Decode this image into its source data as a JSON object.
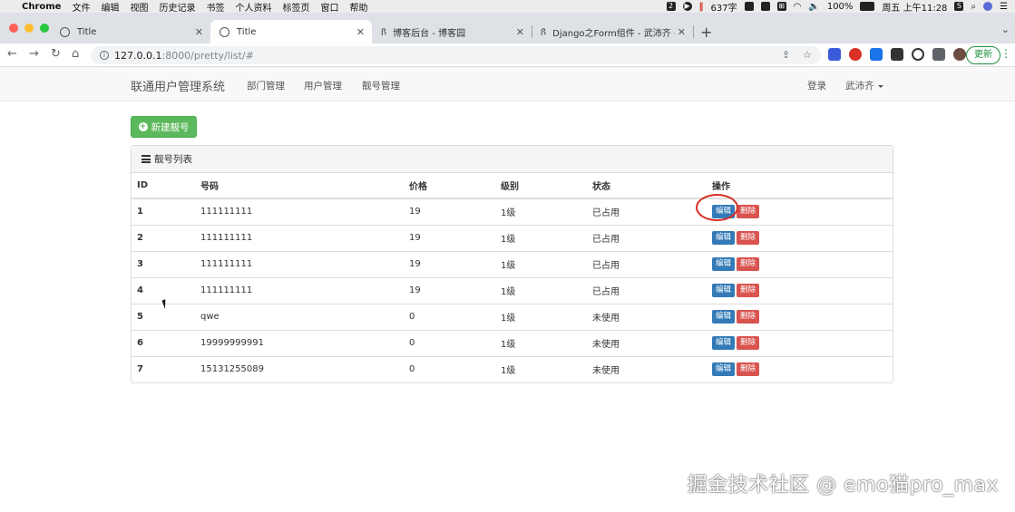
{
  "menubar": {
    "app": "Chrome",
    "items": [
      "文件",
      "编辑",
      "视图",
      "历史记录",
      "书签",
      "个人资料",
      "标签页",
      "窗口",
      "帮助"
    ],
    "badge_count": "2",
    "word_count": "637字",
    "battery": "100%",
    "datetime": "周五 上午11:28"
  },
  "tabs": [
    {
      "title": "Title"
    },
    {
      "title": "Title"
    },
    {
      "title": "博客后台 - 博客园"
    },
    {
      "title": "Django之Form组件 - 武沛齐 - 博"
    }
  ],
  "address": {
    "host": "127.0.0.1",
    "rest": ":8000/pretty/list/#",
    "update_label": "更新"
  },
  "navbar": {
    "brand": "联通用户管理系统",
    "links": [
      "部门管理",
      "用户管理",
      "靓号管理"
    ],
    "login": "登录",
    "user": "武沛齐"
  },
  "content": {
    "new_button": "新建靓号",
    "panel_title": "靓号列表",
    "columns": [
      "ID",
      "号码",
      "价格",
      "级别",
      "状态",
      "操作"
    ],
    "edit_label": "编辑",
    "delete_label": "删除",
    "rows": [
      {
        "id": "1",
        "mobile": "111111111",
        "price": "19",
        "level": "1级",
        "status": "已占用"
      },
      {
        "id": "2",
        "mobile": "111111111",
        "price": "19",
        "level": "1级",
        "status": "已占用"
      },
      {
        "id": "3",
        "mobile": "111111111",
        "price": "19",
        "level": "1级",
        "status": "已占用"
      },
      {
        "id": "4",
        "mobile": "111111111",
        "price": "19",
        "level": "1级",
        "status": "已占用"
      },
      {
        "id": "5",
        "mobile": "qwe",
        "price": "0",
        "level": "1级",
        "status": "未使用"
      },
      {
        "id": "6",
        "mobile": "19999999991",
        "price": "0",
        "level": "1级",
        "status": "未使用"
      },
      {
        "id": "7",
        "mobile": "15131255089",
        "price": "0",
        "level": "1级",
        "status": "未使用"
      }
    ]
  },
  "watermark": "掘金技术社区 @ emo猫pro_max",
  "colors": {
    "primary": "#337ab7",
    "danger": "#d9534f",
    "success": "#5cb85c",
    "annotation": "#d93025"
  }
}
